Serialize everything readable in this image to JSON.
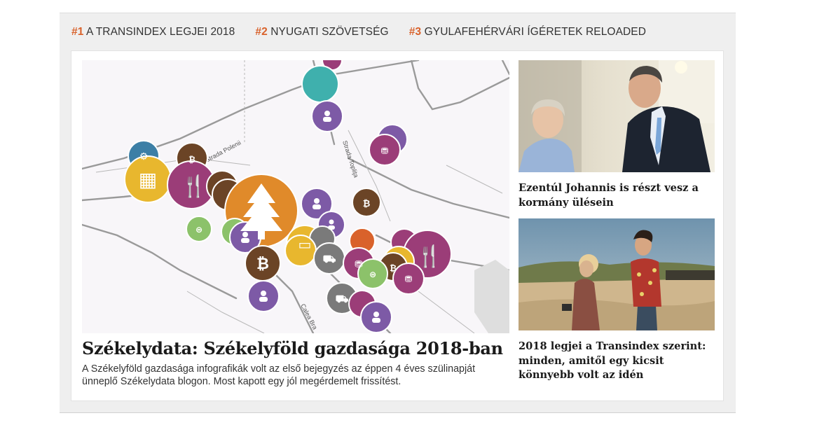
{
  "tabs": [
    {
      "num": "#1",
      "label": "A TRANSINDEX LEGJEI 2018"
    },
    {
      "num": "#2",
      "label": "NYUGATI SZÖVETSÉG"
    },
    {
      "num": "#3",
      "label": "GYULAFEHÉRVÁRI ÍGÉRETEK RELOADED"
    }
  ],
  "main_article": {
    "title": "Székelydata: Székelyföld gazdasága 2018-ban",
    "description": "A Székelyföld gazdasága infografikák volt az első bejegyzés az éppen 4 éves szülinapját ünneplő Székelydata blogon. Most kapott egy jól megérdemelt frissítést.",
    "map_street_labels": [
      "Strada Polenii",
      "Strada Topliţa",
      "Calea Bra"
    ]
  },
  "side_articles": [
    {
      "title": "Ezentúl Johannis is részt vesz a kormány ülésein"
    },
    {
      "title": "2018 legjei a Transindex szerint: minden, amitől egy kicsit könnyebb volt az idén"
    }
  ],
  "colors": {
    "accent": "#d9622b",
    "orange": "#e08a2a",
    "purple": "#7d5aa6",
    "magenta": "#9b3d78",
    "brown": "#6b4426",
    "yellow": "#e8b72e",
    "green": "#8cc26a",
    "teal": "#3fb0ad",
    "gray": "#7a7a7a"
  }
}
